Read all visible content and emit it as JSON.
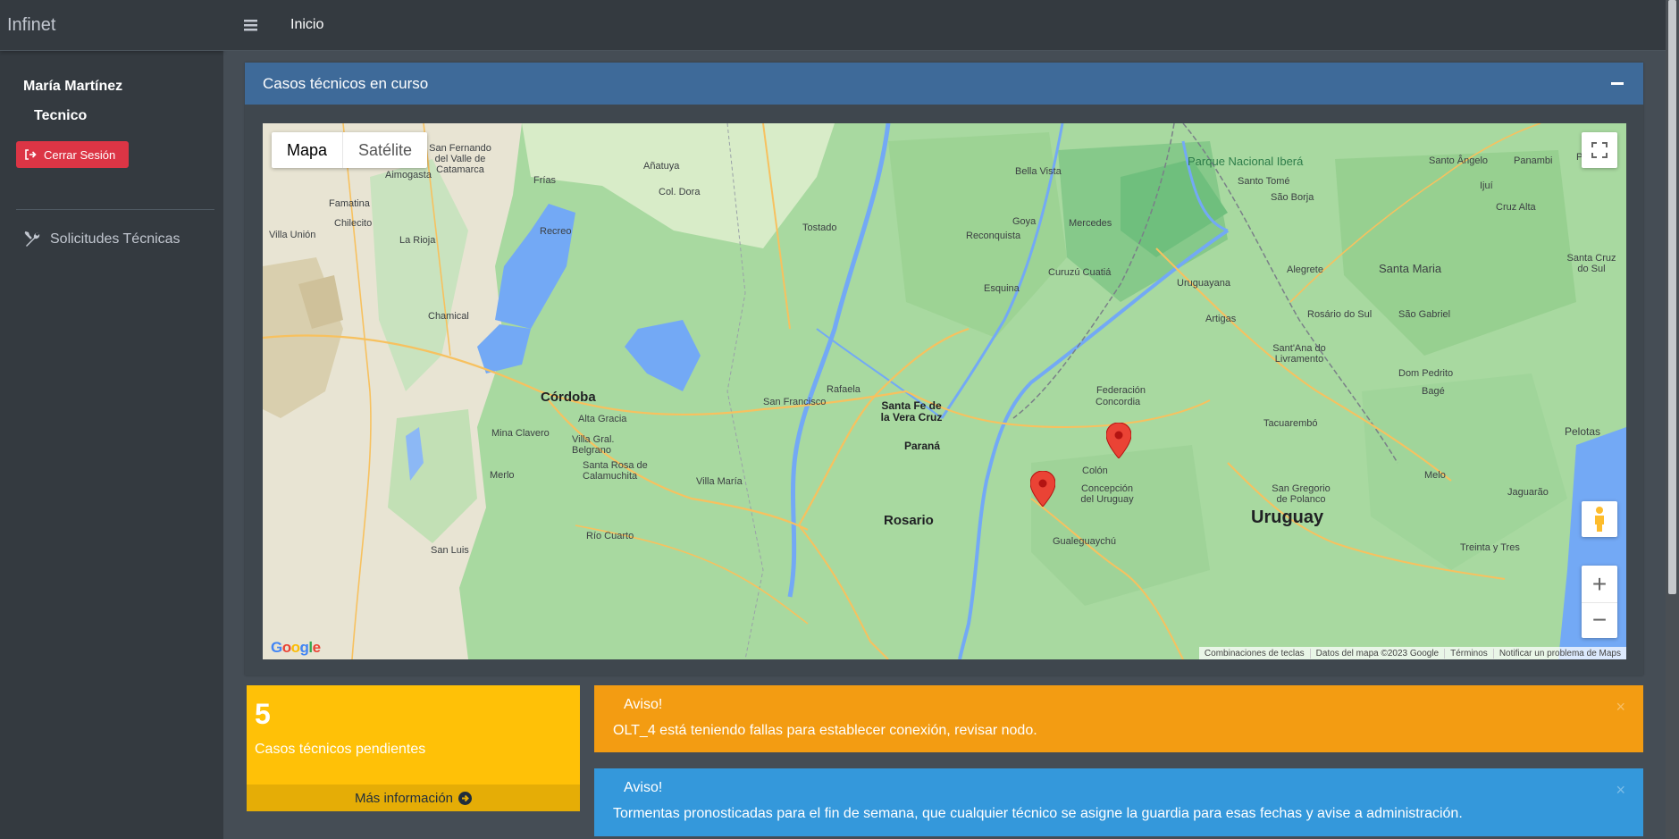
{
  "app": {
    "brand": "Infinet"
  },
  "user": {
    "name": "María Martínez",
    "role": "Tecnico"
  },
  "sidebar": {
    "logout_label": "Cerrar Sesión",
    "nav": [
      {
        "label": "Solicitudes Técnicas",
        "icon": "tools-icon"
      }
    ]
  },
  "topbar": {
    "breadcrumb": "Inicio"
  },
  "card": {
    "title": "Casos técnicos en curso"
  },
  "map": {
    "type_buttons": [
      "Mapa",
      "Satélite"
    ],
    "selected_type": "Mapa",
    "zoom_in": "+",
    "zoom_out": "−",
    "google": "Google",
    "attribution": [
      "Combinaciones de teclas",
      "Datos del mapa ©2023 Google",
      "Términos",
      "Notificar un problema de Maps"
    ],
    "labels": {
      "cordoba": "Córdoba",
      "rosario": "Rosario",
      "parana": "Paraná",
      "santa_fe": "Santa Fe de la Vera Cruz",
      "uruguay": "Uruguay",
      "ibera": "Parque Nacional Iberá",
      "concordia": "Concordia",
      "federacion": "Federación",
      "santa_maria": "Santa Maria",
      "pelotas": "Pelotas",
      "villa_maria": "Villa María",
      "rafaela": "Rafaela",
      "san_francisco": "San Francisco",
      "la_rioja": "La Rioja",
      "san_luis": "San Luis",
      "rio_cuarto": "Río Cuarto",
      "esquina": "Esquina",
      "reconquista": "Reconquista",
      "goya": "Goya",
      "mercedes": "Mercedes",
      "colon": "Colón",
      "gualeguaychu": "Gualeguaychú",
      "tacuarembo": "Tacuarembó",
      "melo": "Melo",
      "alegrete": "Alegrete",
      "uruguayana": "Uruguayana",
      "artigas": "Artigas",
      "rivera": "Sant'Ana do Livramento",
      "bage": "Bagé",
      "tostado": "Tostado",
      "bella_vista": "Bella Vista",
      "santo_tome": "Santo Tomé",
      "sao_borja": "São Borja",
      "alta_gracia": "Alta Gracia",
      "chamical": "Chamical",
      "famatina": "Famatina",
      "chilecito": "Chilecito",
      "recreo": "Recreo",
      "anatuya": "Añatuya",
      "col_dora": "Col. Dora",
      "frias": "Frías",
      "aimogasta": "Aimogasta",
      "villa_union": "Villa Unión",
      "catamarca": "San Fernando del Valle de Catamarca",
      "mina_clavero": "Mina Clavero",
      "merlo": "Merlo",
      "concepcion": "Concepción del Uruguay",
      "curuzu": "Curuzú Cuatiá",
      "rosario_sul": "Rosário do Sul",
      "sao_gabriel": "São Gabriel",
      "dom_pedrito": "Dom Pedrito",
      "jaguarao": "Jaguarão",
      "treinta_tres": "Treinta y Tres",
      "san_gregorio": "San Gregorio de Polanco",
      "santa_cruz_sul": "Santa Cruz do Sul",
      "cruz_alta": "Cruz Alta",
      "santo_angelo": "Santo Ângelo",
      "panambi": "Panambi",
      "ijui": "Ijuí",
      "passo": "Passo",
      "santa_rosa_calamuchita": "Santa Rosa de Calamuchita",
      "villa_gral_belgrano": "Villa Gral. Belgrano"
    }
  },
  "stats": {
    "count": "5",
    "label": "Casos técnicos pendientes",
    "more_label": "Más información"
  },
  "alerts": [
    {
      "title": "Aviso!",
      "message": "OLT_4 está teniendo fallas para establecer conexión, revisar nodo.",
      "color": "#f39c12",
      "close": "×"
    },
    {
      "title": "Aviso!",
      "message": "Tormentas pronosticadas para el fin de semana, que cualquier técnico se asigne la guardia para esas fechas y avise a administración.",
      "color": "#3498db",
      "close": "×"
    }
  ],
  "colors": {
    "sidebar": "#343a40",
    "content": "#454d55",
    "card_header": "#3e6a99",
    "danger": "#dc3545",
    "warning_box": "#ffc107",
    "marker": "#ea4335"
  }
}
